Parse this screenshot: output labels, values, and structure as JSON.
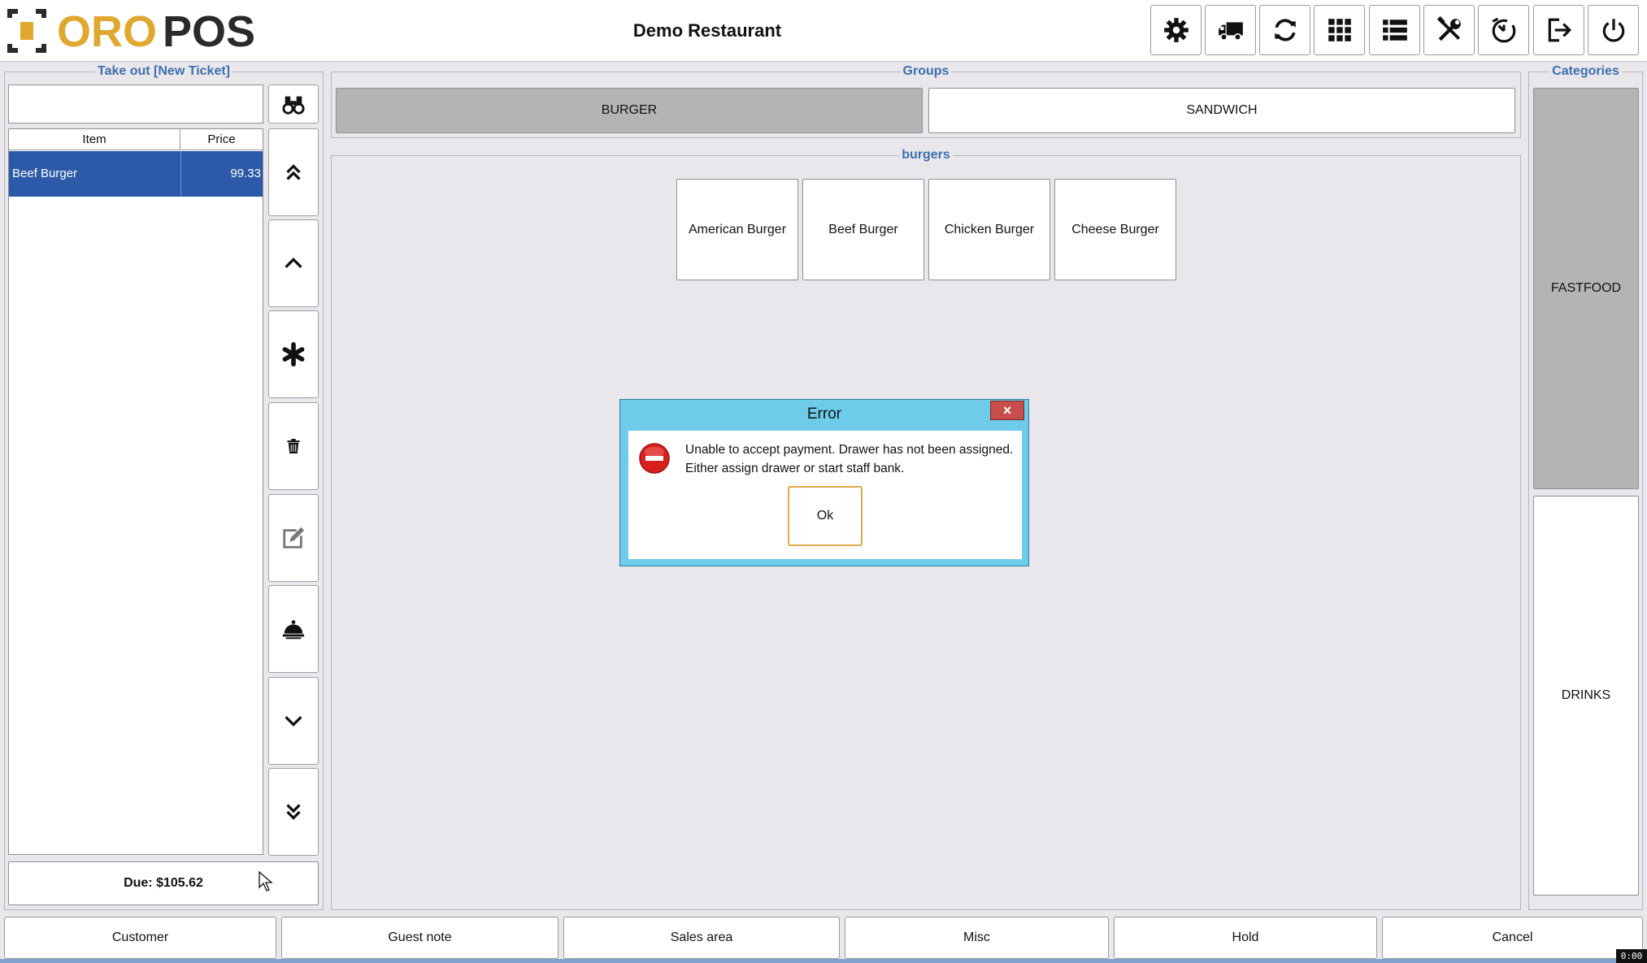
{
  "app": {
    "logo_text_a": "ORO",
    "logo_text_b": "POS",
    "store_title": "Demo Restaurant",
    "brand_color": "#e0a82e"
  },
  "toolbar": [
    {
      "name": "settings-button",
      "icon": "gear-icon"
    },
    {
      "name": "delivery-button",
      "icon": "truck-icon"
    },
    {
      "name": "refresh-button",
      "icon": "refresh-icon"
    },
    {
      "name": "grid-view-button",
      "icon": "grid-icon"
    },
    {
      "name": "list-view-button",
      "icon": "list-icon"
    },
    {
      "name": "tools-button",
      "icon": "tools-icon"
    },
    {
      "name": "clock-button",
      "icon": "clock-icon"
    },
    {
      "name": "logout-button",
      "icon": "logout-icon"
    },
    {
      "name": "power-button",
      "icon": "power-icon"
    }
  ],
  "ticket": {
    "title": "Take out [New Ticket]",
    "search_value": "",
    "columns": [
      "Item",
      "Price"
    ],
    "rows": [
      {
        "item": "Beef Burger",
        "price": "99.33",
        "selected": true
      }
    ],
    "due": "Due: $105.62"
  },
  "side_controls": [
    {
      "name": "search-button",
      "icon": "binoculars-icon"
    },
    {
      "name": "scroll-top-button",
      "icon": "double-chevron-up-icon"
    },
    {
      "name": "scroll-up-button",
      "icon": "chevron-up-icon"
    },
    {
      "name": "modifier-button",
      "icon": "asterisk-icon"
    },
    {
      "name": "delete-button",
      "icon": "trash-icon"
    },
    {
      "name": "edit-button",
      "icon": "edit-icon"
    },
    {
      "name": "cooking-button",
      "icon": "cloche-icon"
    },
    {
      "name": "scroll-down-button",
      "icon": "chevron-down-icon"
    },
    {
      "name": "scroll-bottom-button",
      "icon": "double-chevron-down-icon"
    }
  ],
  "groups": {
    "title": "Groups",
    "items": [
      {
        "label": "BURGER",
        "selected": true
      },
      {
        "label": "SANDWICH",
        "selected": false
      }
    ]
  },
  "menu": {
    "title": "burgers",
    "items": [
      "American Burger",
      "Beef Burger",
      "Chicken Burger",
      "Cheese Burger"
    ]
  },
  "categories": {
    "title": "Categories",
    "items": [
      {
        "label": "FASTFOOD",
        "selected": true
      },
      {
        "label": "DRINKS",
        "selected": false
      }
    ]
  },
  "bottom_bar": [
    "Customer",
    "Guest note",
    "Sales area",
    "Misc",
    "Hold",
    "Cancel"
  ],
  "dialog": {
    "title": "Error",
    "close": "×",
    "message_line1": "Unable to accept payment. Drawer has not been assigned.",
    "message_line2": "Either assign drawer or start staff bank.",
    "ok_label": "Ok",
    "icon": "stop-icon"
  },
  "timer": "0:00"
}
